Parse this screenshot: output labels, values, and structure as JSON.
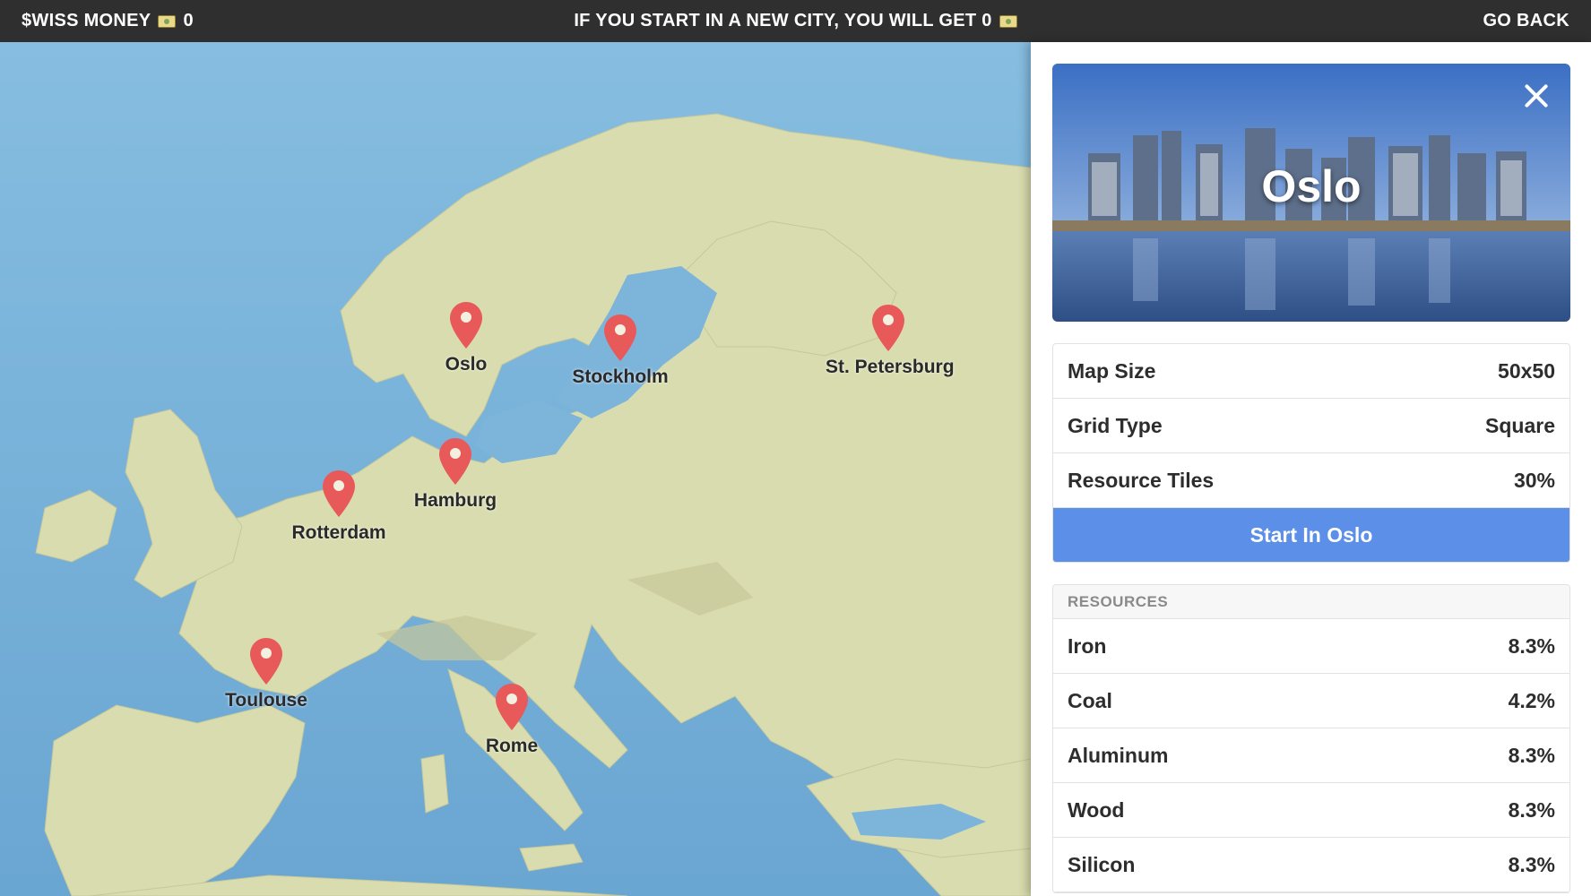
{
  "topbar": {
    "money_label": "$WISS MONEY",
    "money_icon": "money-icon",
    "money_value": "0",
    "notice_text": "IF YOU START IN A NEW CITY, YOU WILL GET 0",
    "go_back_label": "GO BACK"
  },
  "map": {
    "pin_color": "#e8595a",
    "cities": [
      {
        "name": "Oslo"
      },
      {
        "name": "Stockholm"
      },
      {
        "name": "St. Petersburg"
      },
      {
        "name": "Hamburg"
      },
      {
        "name": "Rotterdam"
      },
      {
        "name": "Toulouse"
      },
      {
        "name": "Rome"
      }
    ]
  },
  "panel": {
    "city_title": "Oslo",
    "close_icon": "close-icon",
    "info": [
      {
        "label": "Map Size",
        "value": "50x50"
      },
      {
        "label": "Grid Type",
        "value": "Square"
      },
      {
        "label": "Resource Tiles",
        "value": "30%"
      }
    ],
    "start_button": "Start In Oslo",
    "accent_color": "#5b8fe8",
    "resources_header": "RESOURCES",
    "resources": [
      {
        "label": "Iron",
        "value": "8.3%"
      },
      {
        "label": "Coal",
        "value": "4.2%"
      },
      {
        "label": "Aluminum",
        "value": "8.3%"
      },
      {
        "label": "Wood",
        "value": "8.3%"
      },
      {
        "label": "Silicon",
        "value": "8.3%"
      }
    ]
  }
}
